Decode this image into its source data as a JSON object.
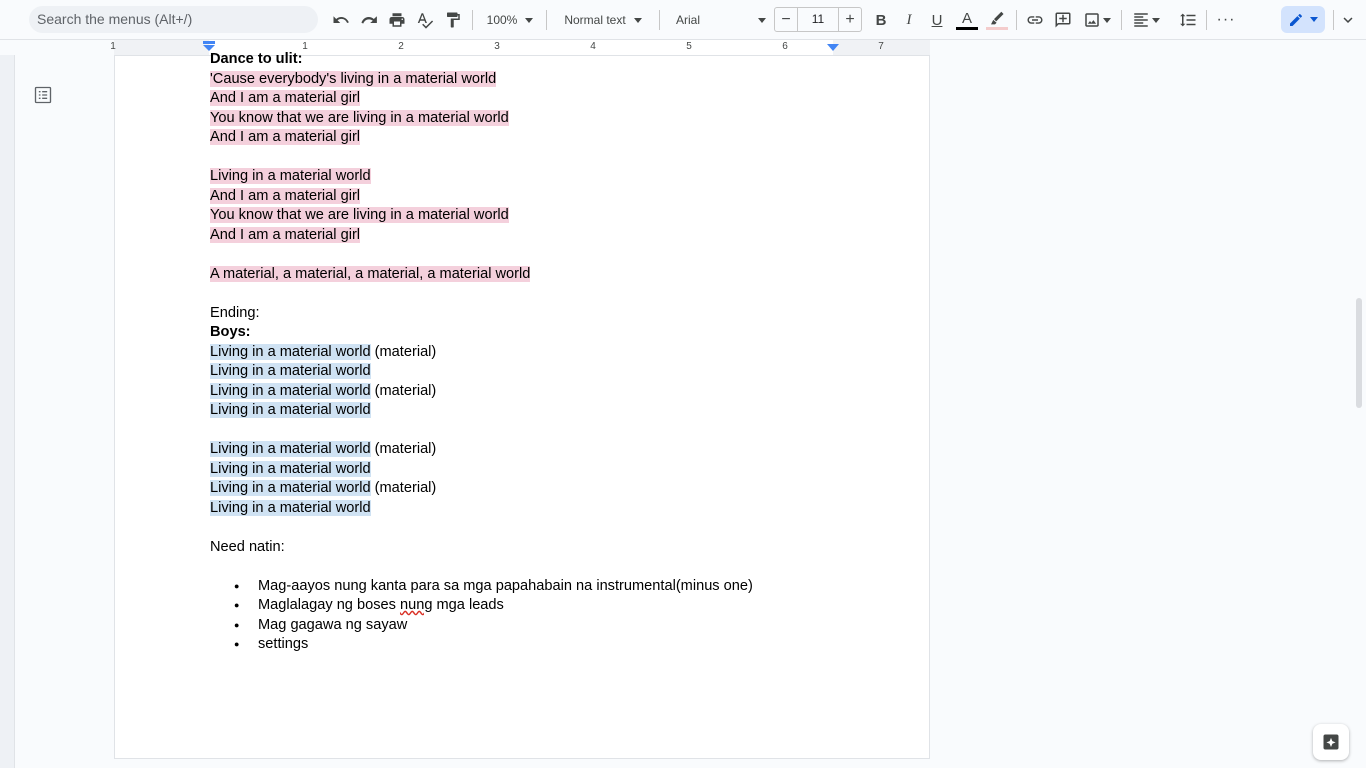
{
  "toolbar": {
    "search_placeholder": "Search the menus (Alt+/)",
    "zoom": "100%",
    "style": "Normal text",
    "font": "Arial",
    "font_size": "11",
    "minus": "−",
    "plus": "+"
  },
  "ruler": {
    "numbers": [
      "1",
      "1",
      "2",
      "3",
      "4",
      "5",
      "6",
      "7"
    ]
  },
  "document": {
    "lines": [
      {
        "text": "Dance to ulit:",
        "style": "bold"
      },
      {
        "text": "'Cause everybody's living in a material world",
        "style": "pink"
      },
      {
        "text": "And I am a material girl",
        "style": "pink"
      },
      {
        "text": "You know that we are living in a material world",
        "style": "pink"
      },
      {
        "text": "And I am a material girl",
        "style": "pink"
      },
      {
        "text": "",
        "style": "blank"
      },
      {
        "text": "Living in a material world",
        "style": "pink"
      },
      {
        "text": "And I am a material girl",
        "style": "pink"
      },
      {
        "text": "You know that we are living in a material world",
        "style": "pink"
      },
      {
        "text": "And I am a material girl",
        "style": "pink"
      },
      {
        "text": "",
        "style": "blank"
      },
      {
        "text": "A material, a material, a material, a material world",
        "style": "pink"
      },
      {
        "text": "",
        "style": "blank"
      },
      {
        "text": "Ending:",
        "style": "plain"
      },
      {
        "text": "Boys:",
        "style": "bold"
      },
      {
        "text": "Living in a material world",
        "suffix": " (material)",
        "style": "blue"
      },
      {
        "text": "Living in a material world",
        "style": "blue"
      },
      {
        "text": "Living in a material world",
        "suffix": " (material)",
        "style": "blue"
      },
      {
        "text": "Living in a material world",
        "style": "blue"
      },
      {
        "text": "",
        "style": "blank"
      },
      {
        "text": "Living in a material world",
        "suffix": " (material)",
        "style": "blue"
      },
      {
        "text": "Living in a material world",
        "style": "blue"
      },
      {
        "text": "Living in a material world",
        "suffix": " (material)",
        "style": "blue"
      },
      {
        "text": "Living in a material world",
        "style": "blue"
      },
      {
        "text": "",
        "style": "blank"
      },
      {
        "text": "Need natin:",
        "style": "plain"
      },
      {
        "text": "",
        "style": "blank"
      }
    ],
    "bullets": [
      "Mag-aayos nung kanta para sa mga papahabain na instrumental(minus one)",
      "Maglalagay ng boses nung mga leads",
      "Mag gagawa ng sayaw",
      "settings"
    ]
  },
  "colors": {
    "pink_highlight": "#f4d0dc",
    "blue_highlight": "#cfe2f3",
    "edit_mode_bg": "#d3e3fd"
  }
}
